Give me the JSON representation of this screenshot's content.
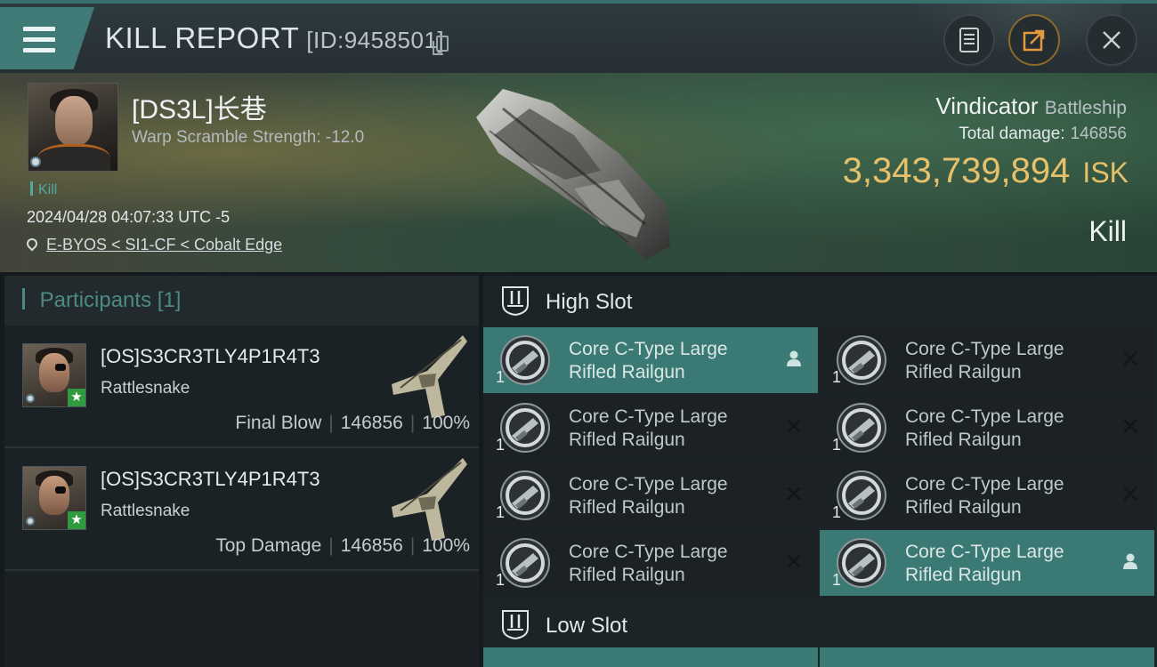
{
  "header": {
    "title": "KILL REPORT",
    "id_label": "[ID:9458501]",
    "actions": [
      "document-icon",
      "share-icon",
      "close-icon"
    ]
  },
  "victim": {
    "name": "[DS3L]长巷",
    "warp_scramble": "Warp Scramble Strength: -12.0",
    "tag": "Kill",
    "datetime": "2024/04/28 04:07:33 UTC -5",
    "location": "E-BYOS < SI1-CF < Cobalt Edge",
    "ship_name": "Vindicator",
    "ship_class": "Battleship",
    "total_damage_label": "Total damage:",
    "total_damage": "146856",
    "isk_value": "3,343,739,894",
    "isk_unit": "ISK",
    "result": "Kill"
  },
  "participants": {
    "title": "Participants",
    "count": "[1]",
    "rows": [
      {
        "name": "[OS]S3CR3TLY4P1R4T3",
        "ship": "Rattlesnake",
        "role": "Final Blow",
        "damage": "146856",
        "percent": "100%"
      },
      {
        "name": "[OS]S3CR3TLY4P1R4T3",
        "ship": "Rattlesnake",
        "role": "Top Damage",
        "damage": "146856",
        "percent": "100%"
      }
    ]
  },
  "slots": {
    "high_title": "High Slot",
    "low_title": "Low Slot",
    "modules": [
      {
        "line1": "Core C-Type Large",
        "line2": "Rifled Railgun",
        "qty": "1",
        "status": "fitted"
      },
      {
        "line1": "Core C-Type Large",
        "line2": "Rifled Railgun",
        "qty": "1",
        "status": "destroyed"
      },
      {
        "line1": "Core C-Type Large",
        "line2": "Rifled Railgun",
        "qty": "1",
        "status": "destroyed"
      },
      {
        "line1": "Core C-Type Large",
        "line2": "Rifled Railgun",
        "qty": "1",
        "status": "destroyed"
      },
      {
        "line1": "Core C-Type Large",
        "line2": "Rifled Railgun",
        "qty": "1",
        "status": "destroyed"
      },
      {
        "line1": "Core C-Type Large",
        "line2": "Rifled Railgun",
        "qty": "1",
        "status": "destroyed"
      },
      {
        "line1": "Core C-Type Large",
        "line2": "Rifled Railgun",
        "qty": "1",
        "status": "destroyed"
      },
      {
        "line1": "Core C-Type Large",
        "line2": "Rifled Railgun",
        "qty": "1",
        "status": "fitted"
      }
    ]
  },
  "colors": {
    "accent": "#3b7a74",
    "isk": "#e7c06c",
    "panel": "#1b2125"
  }
}
